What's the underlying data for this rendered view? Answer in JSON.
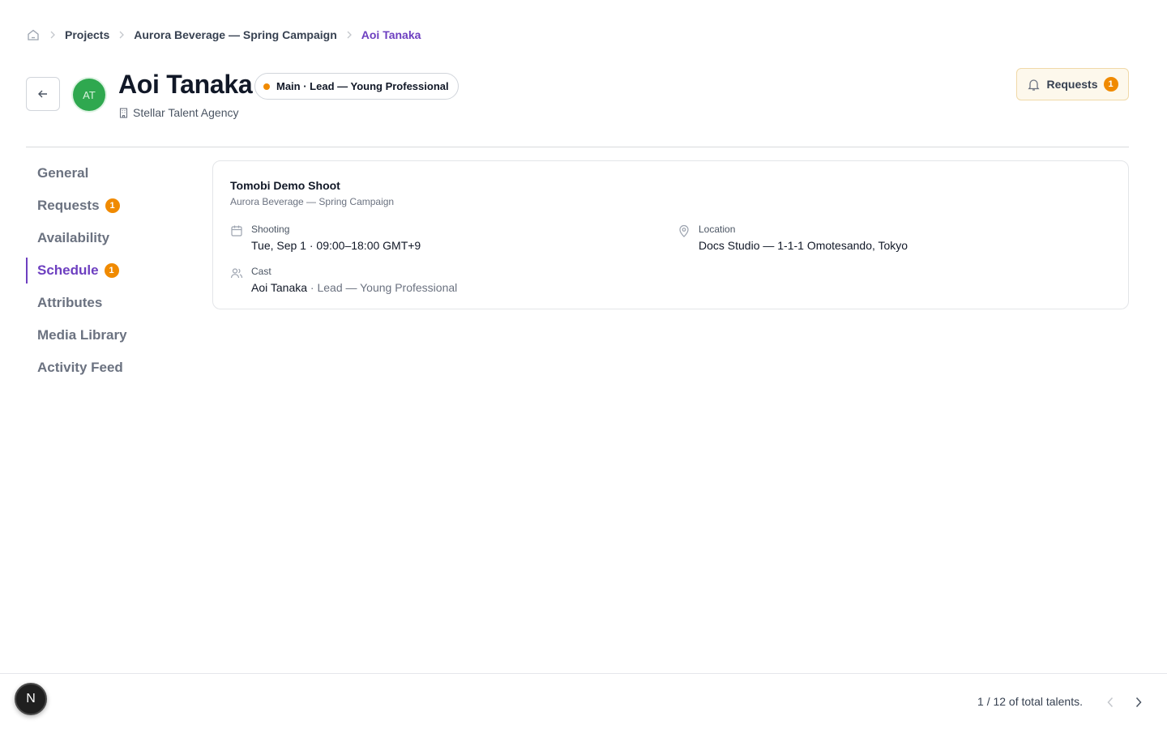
{
  "breadcrumb": {
    "home_icon": "home-icon",
    "items": [
      "Projects",
      "Aurora Beverage — Spring Campaign",
      "Aoi Tanaka"
    ]
  },
  "header": {
    "avatar_initials": "AT",
    "name": "Aoi Tanaka",
    "role_badge": "Main · Lead — Young Professional",
    "agency": "Stellar Talent Agency",
    "requests_label": "Requests",
    "requests_count": "1"
  },
  "sidebar": {
    "items": [
      {
        "label": "General"
      },
      {
        "label": "Requests",
        "badge": "1"
      },
      {
        "label": "Availability"
      },
      {
        "label": "Schedule",
        "badge": "1"
      },
      {
        "label": "Attributes"
      },
      {
        "label": "Media Library"
      },
      {
        "label": "Activity Feed"
      }
    ],
    "active": "Schedule"
  },
  "schedule_card": {
    "title": "Tomobi Demo Shoot",
    "subtitle": "Aurora Beverage — Spring Campaign",
    "shooting_label": "Shooting",
    "shooting_value": "Tue, Sep 1 · 09:00–18:00 GMT+9",
    "location_label": "Location",
    "location_value": "Docs Studio — 1-1-1 Omotesando, Tokyo",
    "cast_label": "Cast",
    "cast_name": "Aoi Tanaka",
    "cast_role": "· Lead — Young Professional"
  },
  "footer": {
    "badge_letter": "N",
    "pager_text": "1 / 12 of total talents."
  },
  "colors": {
    "accent": "#6d3fc0",
    "badge_orange": "#f08a00",
    "avatar_green": "#2fa84f"
  }
}
